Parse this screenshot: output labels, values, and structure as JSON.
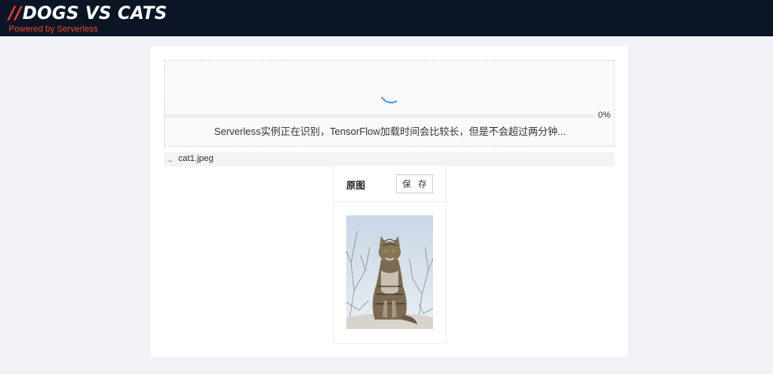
{
  "header": {
    "logo_slash": "//",
    "logo_text": "DOGS VS CATS",
    "tagline": "Powered by Serverless"
  },
  "upload": {
    "progress_percent": 0,
    "progress_label": "0%",
    "status_message": "Serverless实例正在识别，TensorFlow加载时间会比较长，但是不会超过两分钟..."
  },
  "file": {
    "name": "cat1.jpeg"
  },
  "preview": {
    "title": "原图",
    "save_label": "保 存",
    "image_icon": "cat-photo"
  },
  "colors": {
    "header_bg": "#0b1526",
    "brand_accent": "#e8452c",
    "spinner": "#4a90e2"
  }
}
